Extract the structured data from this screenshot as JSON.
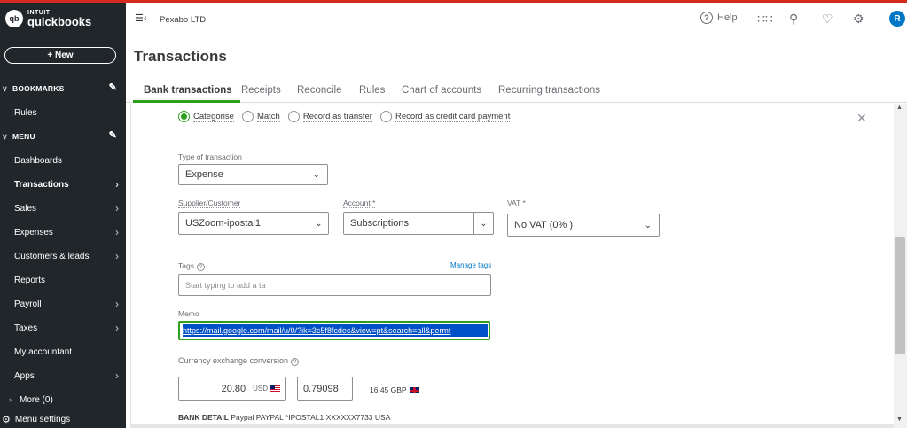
{
  "brand": {
    "logo_mark": "qb",
    "line1": "INTUIT",
    "line2": "quickbooks"
  },
  "sidebar": {
    "new_label": "+ New",
    "bookmarks_label": "BOOKMARKS",
    "menu_label": "MENU",
    "items": [
      {
        "label": "Rules"
      },
      {
        "label": "Dashboards"
      },
      {
        "label": "Transactions"
      },
      {
        "label": "Sales"
      },
      {
        "label": "Expenses"
      },
      {
        "label": "Customers & leads"
      },
      {
        "label": "Reports"
      },
      {
        "label": "Payroll"
      },
      {
        "label": "Taxes"
      },
      {
        "label": "My accountant"
      },
      {
        "label": "Apps"
      },
      {
        "label": "More (0)"
      }
    ],
    "menu_settings": "Menu settings"
  },
  "topbar": {
    "company": "Pexabo LTD",
    "help_label": "Help",
    "avatar_initial": "R"
  },
  "page_title": "Transactions",
  "tabs": [
    {
      "label": "Bank transactions"
    },
    {
      "label": "Receipts"
    },
    {
      "label": "Reconcile"
    },
    {
      "label": "Rules"
    },
    {
      "label": "Chart of accounts"
    },
    {
      "label": "Recurring transactions"
    }
  ],
  "form": {
    "radios": [
      {
        "label": "Categorise",
        "selected": true
      },
      {
        "label": "Match",
        "selected": false
      },
      {
        "label": "Record as transfer",
        "selected": false
      },
      {
        "label": "Record as credit card payment",
        "selected": false
      }
    ],
    "type_label": "Type of transaction",
    "type_value": "Expense",
    "supplier_label": "Supplier/Customer",
    "supplier_value": "USZoom-ipostal1",
    "account_label": "Account *",
    "account_value": "Subscriptions",
    "vat_label": "VAT *",
    "vat_value": "No VAT (0% )",
    "tags_label": "Tags",
    "manage_tags": "Manage tags",
    "tags_placeholder": "Start typing to add a ta",
    "memo_label": "Memo",
    "memo_value": "https://mail.google.com/mail/u/0/?ik=3c5f8fcdec&view=pt&search=all&permt",
    "currency_label": "Currency exchange conversion",
    "amount_value": "20.80",
    "amount_currency": "USD",
    "rate_value": "0.79098",
    "converted_value": "16.45 GBP",
    "bank_detail_label": "BANK DETAIL",
    "bank_detail_value": "Paypal PAYPAL *IPOSTAL1 XXXXXX7733 USA"
  }
}
